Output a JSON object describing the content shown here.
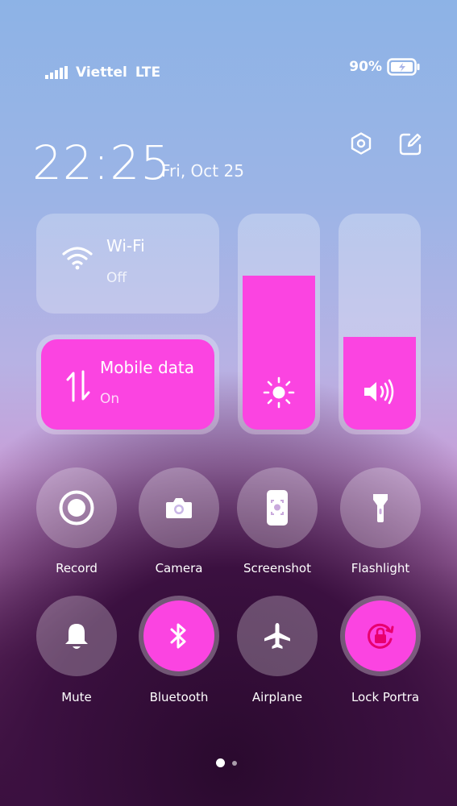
{
  "status": {
    "carrier": "Viettel",
    "network": "LTE",
    "battery": "90%",
    "battery_level": 0.9
  },
  "header": {
    "time": "22:25",
    "date": "Fri, Oct 25"
  },
  "tiles": {
    "wifi": {
      "title": "Wi-Fi",
      "state": "Off",
      "icon": "wifi-icon"
    },
    "mobile_data": {
      "title": "Mobile data",
      "state": "On",
      "icon": "mobile-data-icon"
    }
  },
  "sliders": {
    "brightness_level": 0.73,
    "volume_level": 0.44
  },
  "toggles": [
    {
      "label": "Record",
      "icon": "record-icon",
      "on": false
    },
    {
      "label": "Camera",
      "icon": "camera-icon",
      "on": false
    },
    {
      "label": "Screenshot",
      "icon": "screenshot-icon",
      "on": false
    },
    {
      "label": "Flashlight",
      "icon": "flashlight-icon",
      "on": false
    },
    {
      "label": "Mute",
      "icon": "bell-icon",
      "on": false
    },
    {
      "label": "Bluetooth",
      "icon": "bluetooth-icon",
      "on": true
    },
    {
      "label": "Airplane",
      "icon": "airplane-icon",
      "on": false
    },
    {
      "label": "Lock Portra",
      "icon": "rotation-lock-icon",
      "on": true
    }
  ],
  "colors": {
    "accent": "#fb44e1",
    "lock_icon": "#e8006e"
  },
  "pager": {
    "page": 1,
    "pages": 2
  }
}
